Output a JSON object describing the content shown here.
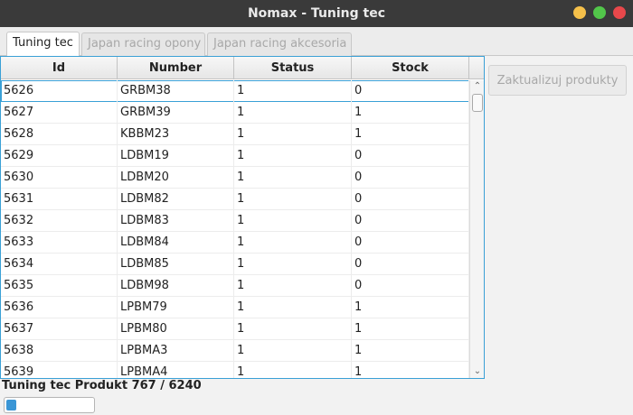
{
  "window": {
    "title": "Nomax - Tuning tec"
  },
  "tabs": [
    {
      "label": "Tuning tec",
      "active": true
    },
    {
      "label": "Japan racing opony",
      "active": false
    },
    {
      "label": "Japan racing akcesoria",
      "active": false
    }
  ],
  "table": {
    "columns": [
      "Id",
      "Number",
      "Status",
      "Stock"
    ],
    "rows": [
      {
        "id": "5626",
        "number": "GRBM38",
        "status": "1",
        "stock": "0"
      },
      {
        "id": "5627",
        "number": "GRBM39",
        "status": "1",
        "stock": "1"
      },
      {
        "id": "5628",
        "number": "KBBM23",
        "status": "1",
        "stock": "1"
      },
      {
        "id": "5629",
        "number": "LDBM19",
        "status": "1",
        "stock": "0"
      },
      {
        "id": "5630",
        "number": "LDBM20",
        "status": "1",
        "stock": "0"
      },
      {
        "id": "5631",
        "number": "LDBM82",
        "status": "1",
        "stock": "0"
      },
      {
        "id": "5632",
        "number": "LDBM83",
        "status": "1",
        "stock": "0"
      },
      {
        "id": "5633",
        "number": "LDBM84",
        "status": "1",
        "stock": "0"
      },
      {
        "id": "5634",
        "number": "LDBM85",
        "status": "1",
        "stock": "0"
      },
      {
        "id": "5635",
        "number": "LDBM98",
        "status": "1",
        "stock": "0"
      },
      {
        "id": "5636",
        "number": "LPBM79",
        "status": "1",
        "stock": "1"
      },
      {
        "id": "5637",
        "number": "LPBM80",
        "status": "1",
        "stock": "1"
      },
      {
        "id": "5638",
        "number": "LPBMA3",
        "status": "1",
        "stock": "1"
      },
      {
        "id": "5639",
        "number": "LPBMA4",
        "status": "1",
        "stock": "1"
      }
    ]
  },
  "actions": {
    "update_label": "Zaktualizuj produkty"
  },
  "status": {
    "text": "Tuning tec Produkt 767 / 6240",
    "progress": 0.12
  },
  "colors": {
    "accent": "#3a96d6",
    "titlebar": "#3a3a3a"
  },
  "icons": {
    "scroll_up": "chevron-up-icon",
    "scroll_down": "chevron-down-icon"
  }
}
